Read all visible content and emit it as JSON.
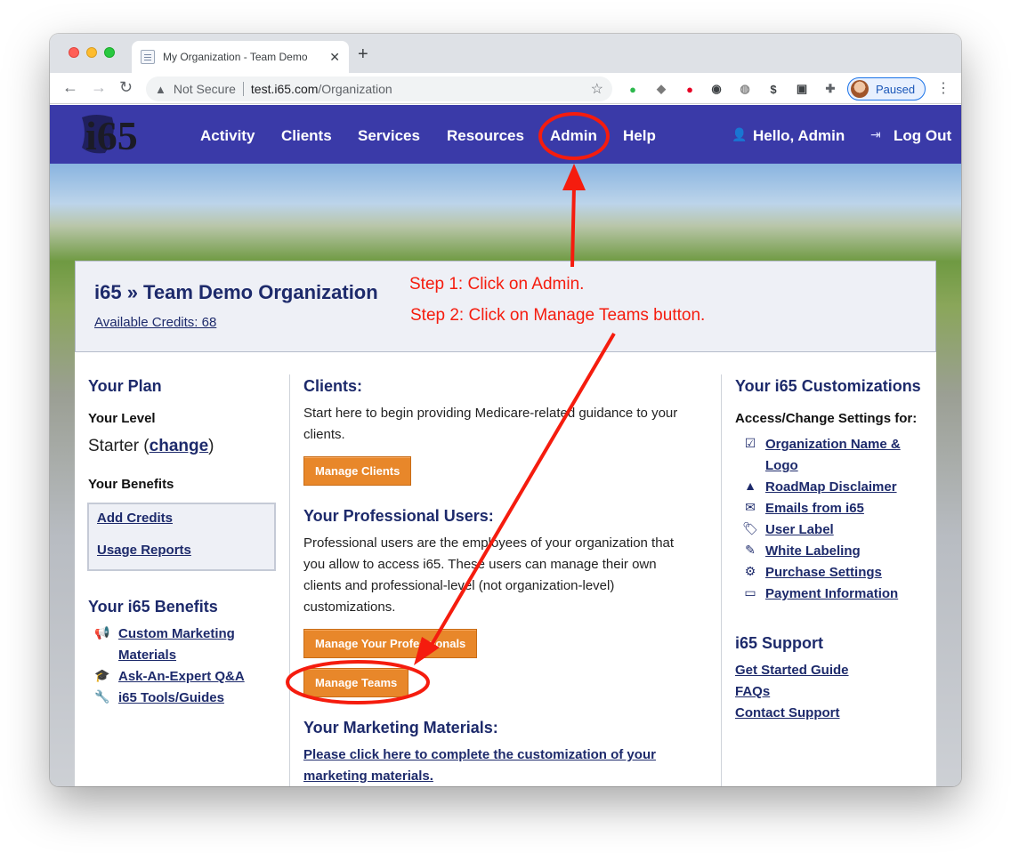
{
  "browser": {
    "tab_title": "My Organization - Team Demo",
    "tab_close": "✕",
    "new_tab": "+",
    "not_secure": "Not Secure",
    "url_host": "test.i65.com",
    "url_path": "/Organization",
    "profile_label": "Paused"
  },
  "header": {
    "logo_text": "i65",
    "nav": [
      "Activity",
      "Clients",
      "Services",
      "Resources",
      "Admin",
      "Help"
    ],
    "greeting": "Hello, Admin",
    "logout": "Log Out"
  },
  "org": {
    "title": "i65 » Team Demo Organization",
    "credits": "Available Credits: 68"
  },
  "left": {
    "plan_heading": "Your Plan",
    "level_heading": "Your Level",
    "level_value": "Starter",
    "change_link": "change",
    "benefits_heading": "Your Benefits",
    "add_credits": "Add Credits",
    "usage_reports": "Usage Reports",
    "i65_benefits_heading": "Your i65 Benefits",
    "benefit_links": [
      "Custom Marketing",
      "Materials",
      "Ask-An-Expert Q&A",
      "i65 Tools/Guides"
    ]
  },
  "middle": {
    "clients_heading": "Clients:",
    "clients_text_1": "Start here to begin providing Medicare-related guidance to your",
    "clients_text_2": "clients.",
    "manage_clients": "Manage Clients",
    "pro_heading": "Your Professional Users:",
    "pro_text": [
      "Professional users are the employees of your organization that",
      "you allow to access i65. These users can manage their own",
      "clients and professional-level (not organization-level)",
      "customizations."
    ],
    "manage_pros": "Manage Your Professionals",
    "manage_teams": "Manage Teams",
    "marketing_heading": "Your Marketing Materials:",
    "marketing_link_1": "Please click here to complete the customization of your",
    "marketing_link_2": "marketing materials."
  },
  "right": {
    "custom_heading": "Your i65 Customizations",
    "access_heading": "Access/Change Settings for:",
    "settings_links": [
      "Organization Name &",
      "Logo",
      "RoadMap Disclaimer",
      "Emails from i65",
      "User Label",
      "White Labeling",
      "Purchase Settings",
      "Payment Information"
    ],
    "support_heading": "i65 Support",
    "support_links": [
      "Get Started Guide",
      "FAQs",
      "Contact Support"
    ]
  },
  "annotations": {
    "step1": "Step 1: Click on Admin.",
    "step2": "Step 2: Click on Manage Teams button.",
    "color": "#f51c0e"
  }
}
